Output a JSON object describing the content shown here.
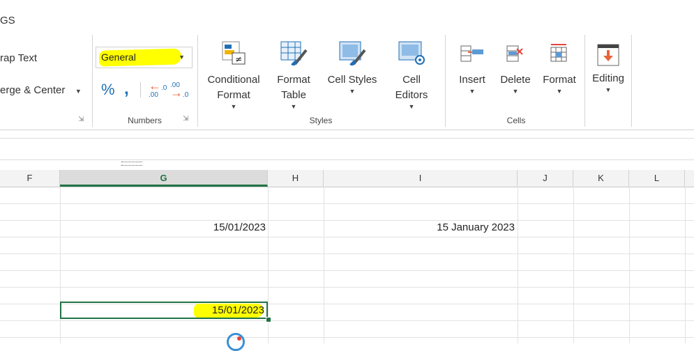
{
  "tab_title": "GS",
  "alignment": {
    "wrap_text_label": "rap Text",
    "merge_center_label": "erge & Center"
  },
  "numbers": {
    "format_value": "General",
    "percent_symbol": "%",
    "comma_symbol": "&#8217;",
    "increase_decimal": "←.0\n.00",
    "decrease_decimal": ".00\n→.0",
    "group_label": "Numbers"
  },
  "styles": {
    "conditional_format_line1": "Conditional",
    "conditional_format_line2": "Format",
    "format_table_line1": "Format",
    "format_table_line2": "Table",
    "cell_styles_label": "Cell Styles",
    "cell_editors_line1": "Cell",
    "cell_editors_line2": "Editors",
    "group_label": "Styles"
  },
  "cells": {
    "insert_label": "Insert",
    "delete_label": "Delete",
    "format_label": "Format",
    "group_label": "Cells"
  },
  "editing": {
    "label": "Editing"
  },
  "columns": [
    "F",
    "G",
    "H",
    "I",
    "J",
    "K",
    "L"
  ],
  "grid": {
    "g_row3": "15/01/2023",
    "i_row3": "15 January 2023",
    "g_active": "15/01/2023"
  },
  "colors": {
    "highlight": "#ffff00",
    "excel_green": "#217346",
    "icon_blue": "#1f6fb5",
    "icon_orange": "#e8643a"
  },
  "icons": {
    "conditional_format": "conditional-format-icon",
    "format_table": "format-table-icon",
    "cell_styles": "cell-styles-icon",
    "cell_editors": "cell-editors-icon",
    "insert": "insert-cells-icon",
    "delete": "delete-cells-icon",
    "format": "format-cells-icon",
    "editing": "editing-icon"
  }
}
